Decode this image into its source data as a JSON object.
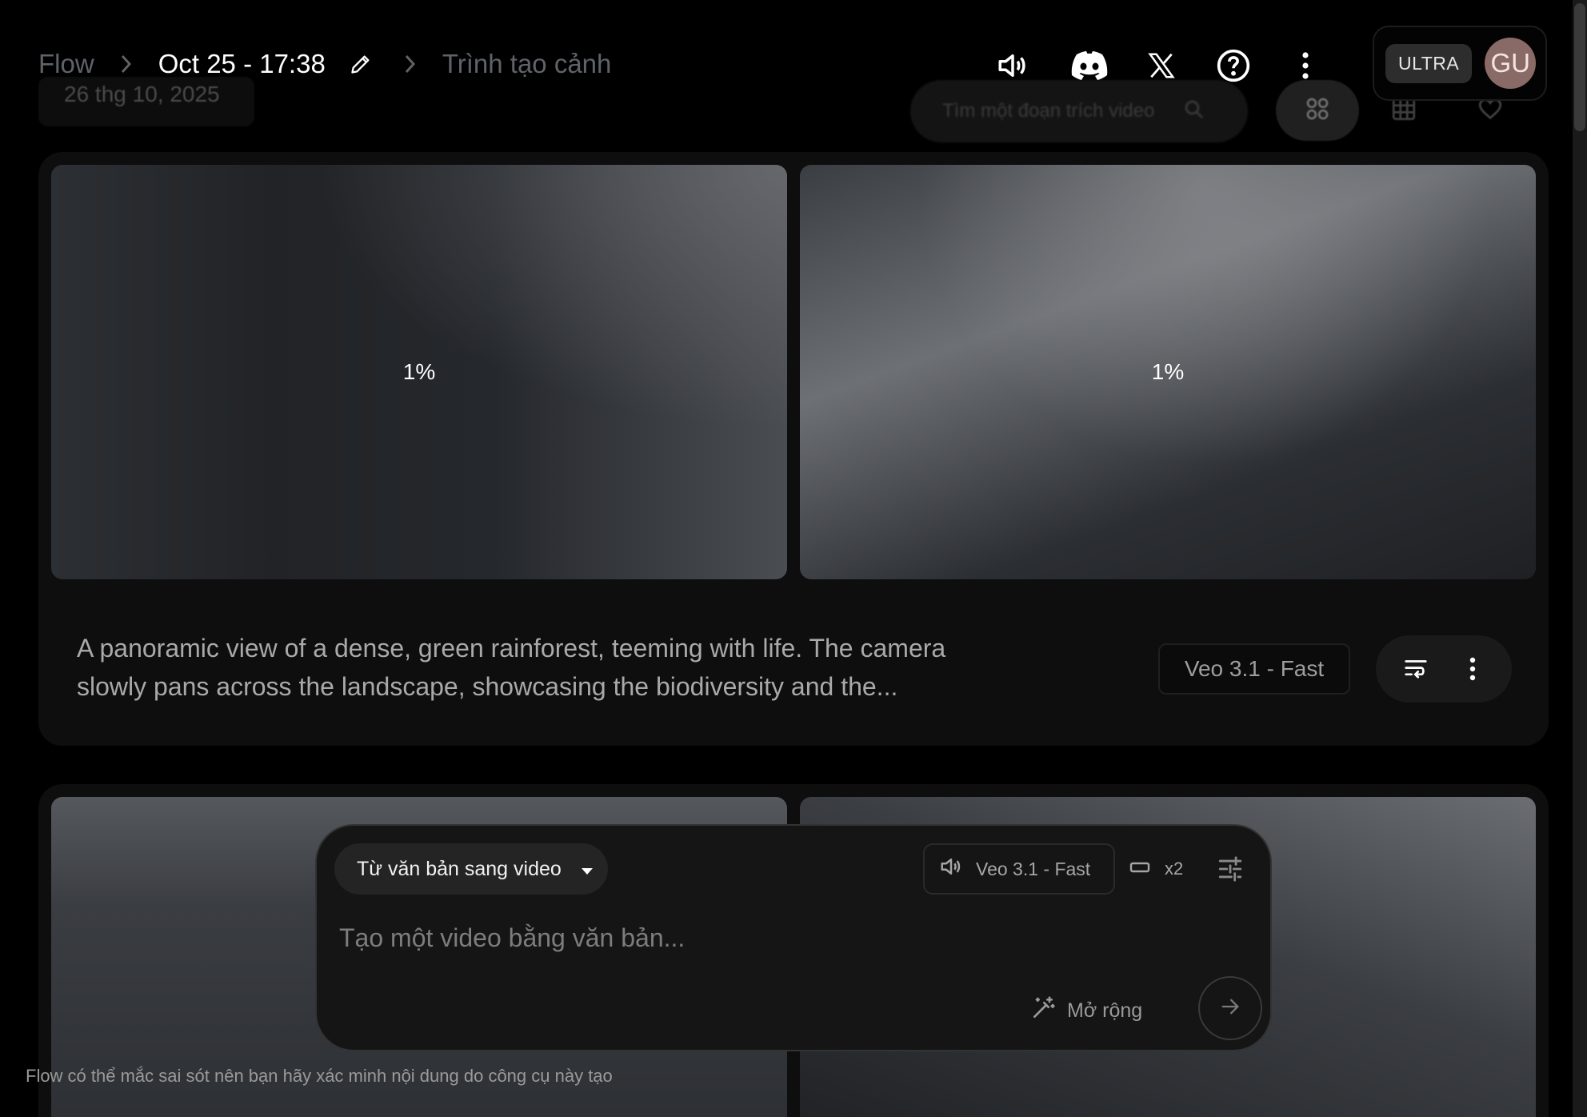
{
  "header": {
    "breadcrumb_root": "Flow",
    "breadcrumb_current": "Oct 25 - 17:38",
    "breadcrumb_last": "Trình tạo cảnh",
    "date_label": "26 thg 10, 2025",
    "search_placeholder": "Tìm một đoạn trích video",
    "plan_badge": "ULTRA",
    "avatar_initials": "GU"
  },
  "icons": {
    "breadcrumb_separator": "chevron-right-icon",
    "edit": "pencil-icon",
    "sound": "volume-icon",
    "discord": "discord-icon",
    "x": "x-logo-icon",
    "help": "help-circle-icon",
    "more": "more-vertical-icon",
    "search": "search-icon",
    "grid_view": "grid-view-icon",
    "table_view": "table-view-icon",
    "favorites": "heart-icon"
  },
  "results": [
    {
      "thumb1_progress": "1%",
      "thumb2_progress": "1%",
      "prompt": "A panoramic view of a dense, green rainforest, teeming with life. The camera slowly pans across the landscape, showcasing the biodiversity and the...",
      "model": "Veo 3.1 - Fast"
    }
  ],
  "composer": {
    "mode_label": "Từ văn bản sang video",
    "model_label": "Veo 3.1 - Fast",
    "count_label": "x2",
    "placeholder": "Tạo một video bằng văn bản...",
    "expand_label": "Mở rộng"
  },
  "footer": {
    "disclaimer": "Flow có thể mắc sai sót nên bạn hãy xác minh nội dung do công cụ này tạo"
  },
  "colors": {
    "background": "#000000",
    "card": "#0e0e0e",
    "composer": "#151515",
    "avatar": "#8a6a66"
  }
}
